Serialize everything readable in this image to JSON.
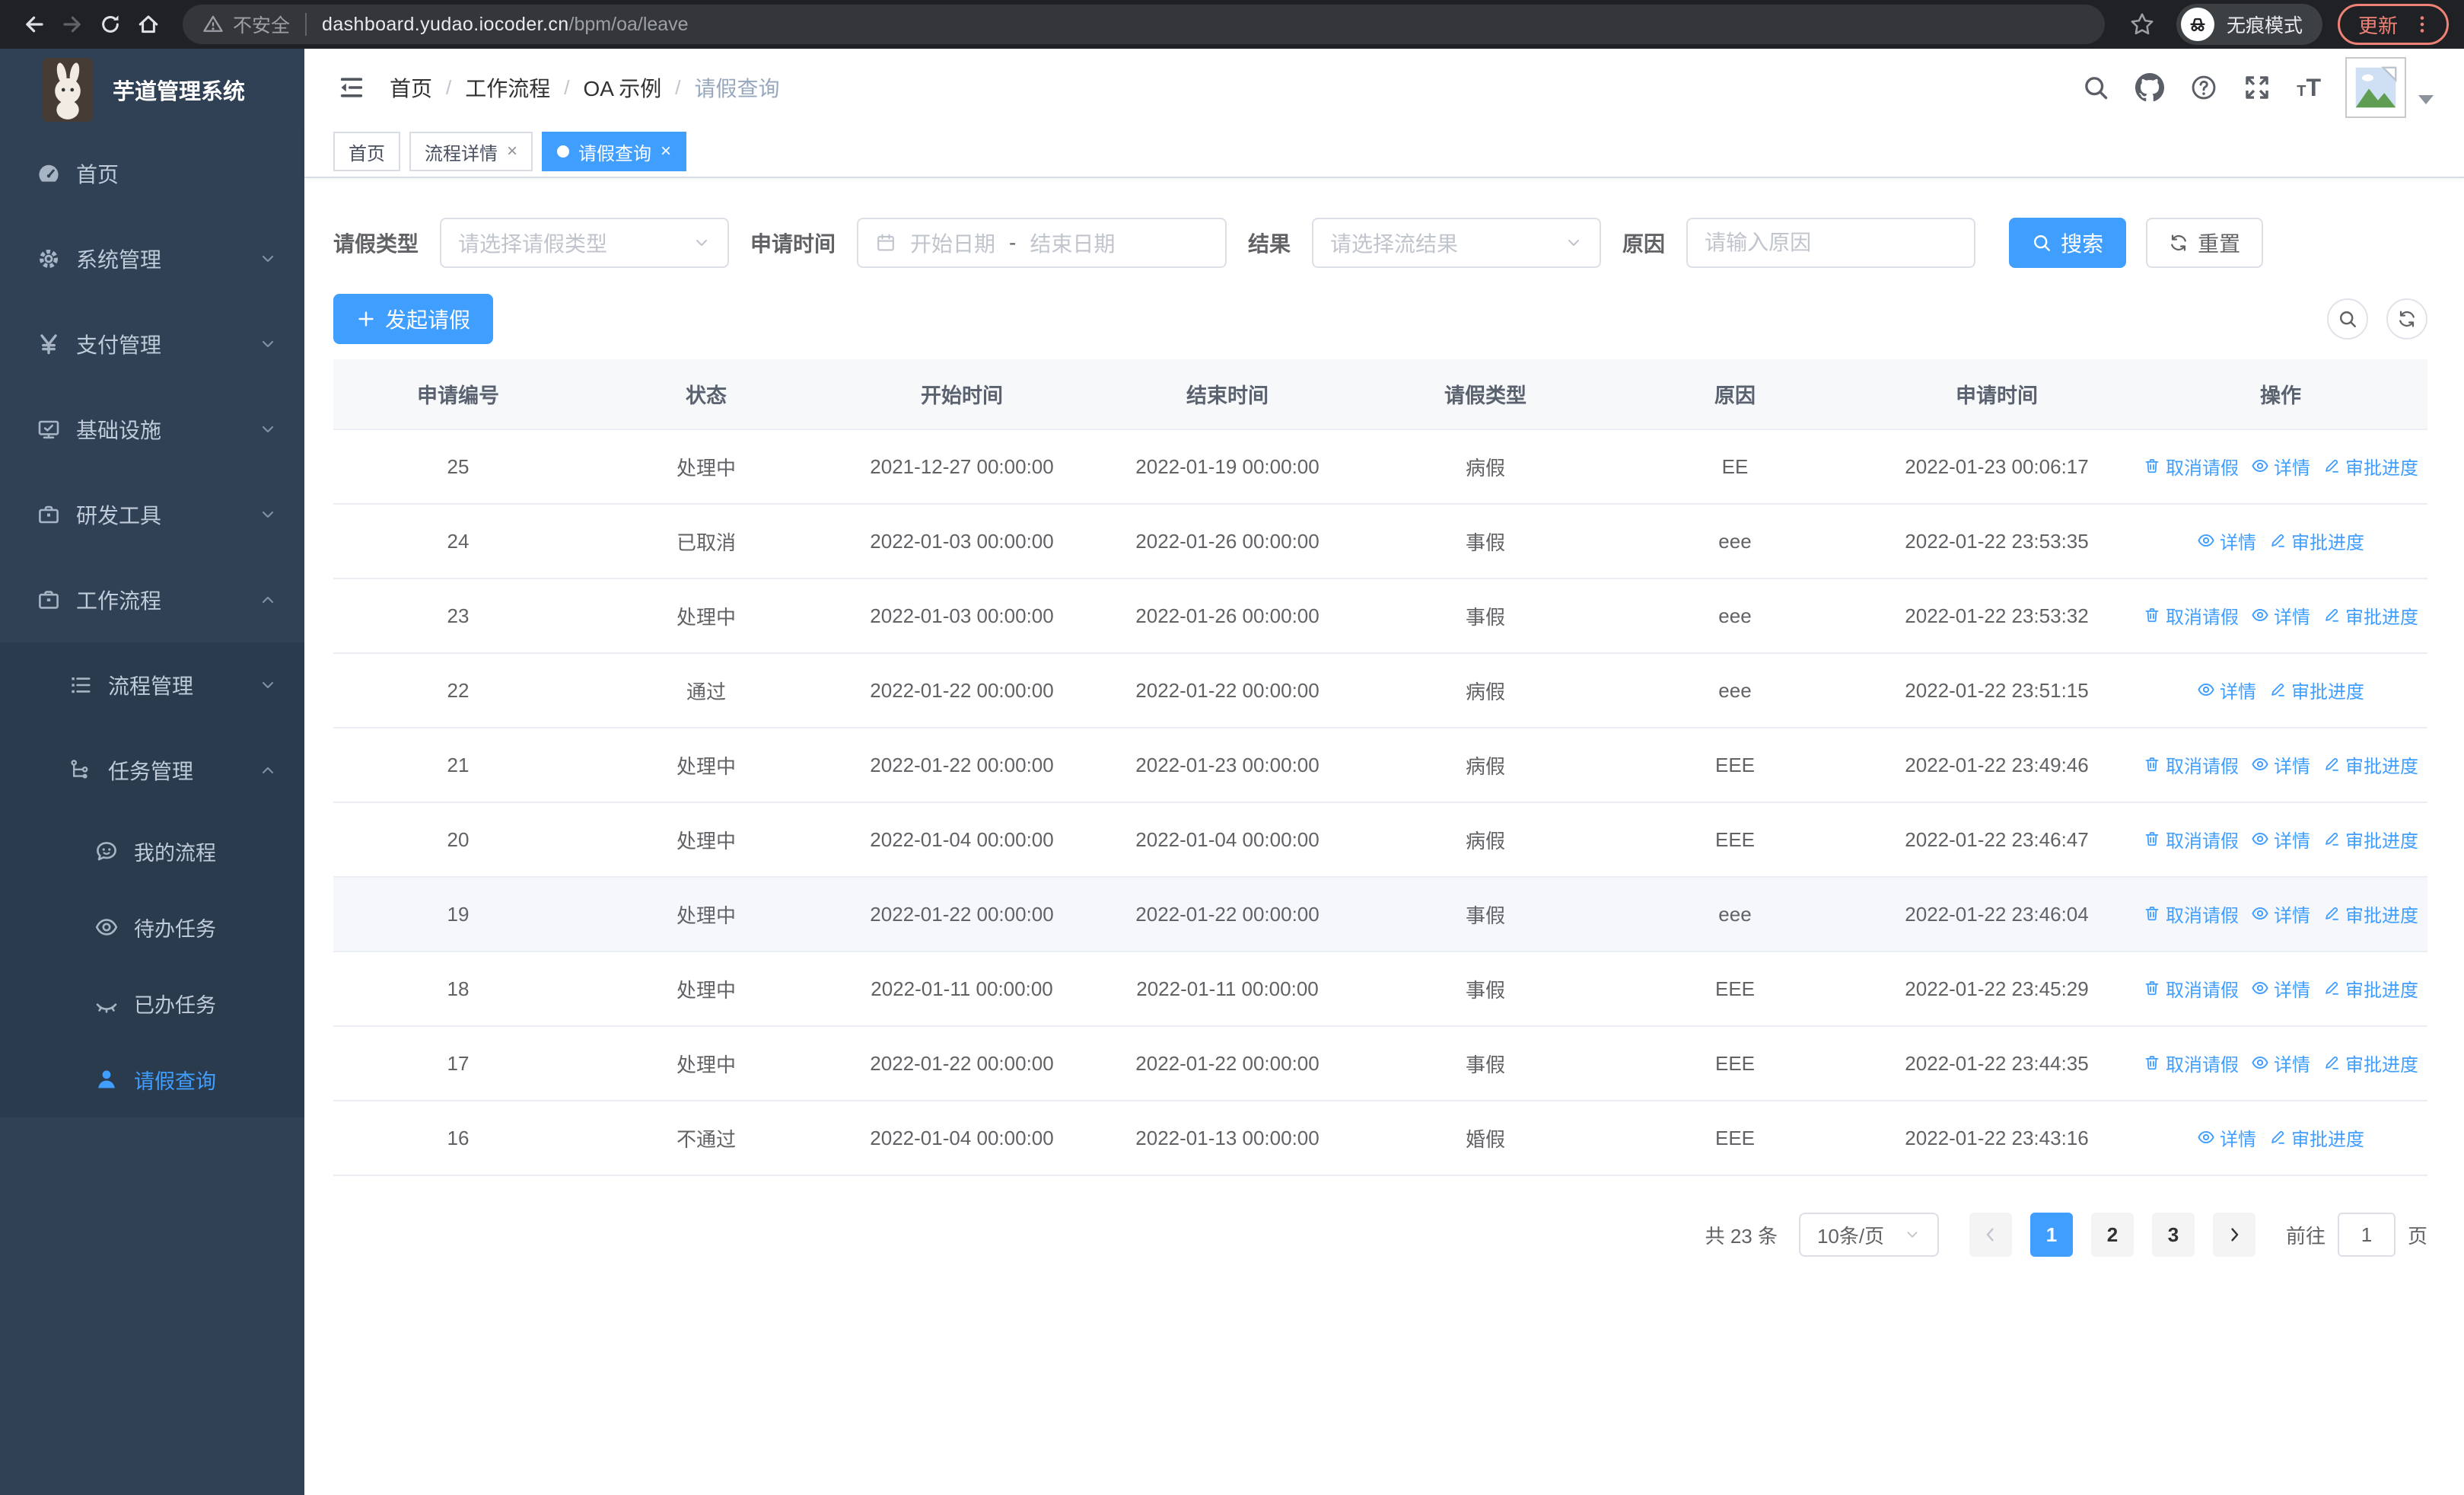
{
  "colors": {
    "primary": "#409EFF",
    "sidebar_bg": "#304156",
    "sidebar_sub_bg": "#2B3B4E",
    "sidebar_text": "#BFCBD9",
    "update_accent": "#EE8277",
    "table_border": "#EBEEF5",
    "header_row_bg": "#F7F8FA"
  },
  "browser": {
    "security_label": "不安全",
    "url_host": "dashboard.yudao.iocoder.cn",
    "url_path": "/bpm/oa/leave",
    "incognito_label": "无痕模式",
    "update_label": "更新"
  },
  "sidebar": {
    "title": "芋道管理系统",
    "items": [
      {
        "label": "首页"
      },
      {
        "label": "系统管理"
      },
      {
        "label": "支付管理"
      },
      {
        "label": "基础设施"
      },
      {
        "label": "研发工具"
      },
      {
        "label": "工作流程"
      }
    ],
    "sub_items": [
      {
        "label": "流程管理"
      },
      {
        "label": "任务管理"
      }
    ],
    "task_children": [
      {
        "label": "我的流程"
      },
      {
        "label": "待办任务"
      },
      {
        "label": "已办任务"
      },
      {
        "label": "请假查询"
      }
    ]
  },
  "header": {
    "breadcrumb": [
      "首页",
      "工作流程",
      "OA 示例",
      "请假查询"
    ],
    "breadcrumb_sep": "/"
  },
  "tabs": [
    {
      "label": "首页"
    },
    {
      "label": "流程详情"
    },
    {
      "label": "请假查询"
    }
  ],
  "filters": {
    "type_label": "请假类型",
    "type_placeholder": "请选择请假类型",
    "time_label": "申请时间",
    "time_start": "开始日期",
    "time_sep": "-",
    "time_end": "结束日期",
    "result_label": "结果",
    "result_placeholder": "请选择流结果",
    "reason_label": "原因",
    "reason_placeholder": "请输入原因",
    "search": "搜索",
    "reset": "重置"
  },
  "toolbar": {
    "create": "发起请假"
  },
  "table": {
    "columns": [
      "申请编号",
      "状态",
      "开始时间",
      "结束时间",
      "请假类型",
      "原因",
      "申请时间",
      "操作"
    ],
    "actions": {
      "cancel": "取消请假",
      "detail": "详情",
      "progress": "审批进度"
    },
    "rows": [
      {
        "id": "25",
        "status": "处理中",
        "start": "2021-12-27 00:00:00",
        "end": "2022-01-19 00:00:00",
        "type": "病假",
        "reason": "EE",
        "applied": "2022-01-23 00:06:17"
      },
      {
        "id": "24",
        "status": "已取消",
        "start": "2022-01-03 00:00:00",
        "end": "2022-01-26 00:00:00",
        "type": "事假",
        "reason": "eee",
        "applied": "2022-01-22 23:53:35"
      },
      {
        "id": "23",
        "status": "处理中",
        "start": "2022-01-03 00:00:00",
        "end": "2022-01-26 00:00:00",
        "type": "事假",
        "reason": "eee",
        "applied": "2022-01-22 23:53:32"
      },
      {
        "id": "22",
        "status": "通过",
        "start": "2022-01-22 00:00:00",
        "end": "2022-01-22 00:00:00",
        "type": "病假",
        "reason": "eee",
        "applied": "2022-01-22 23:51:15"
      },
      {
        "id": "21",
        "status": "处理中",
        "start": "2022-01-22 00:00:00",
        "end": "2022-01-23 00:00:00",
        "type": "病假",
        "reason": "EEE",
        "applied": "2022-01-22 23:49:46"
      },
      {
        "id": "20",
        "status": "处理中",
        "start": "2022-01-04 00:00:00",
        "end": "2022-01-04 00:00:00",
        "type": "病假",
        "reason": "EEE",
        "applied": "2022-01-22 23:46:47"
      },
      {
        "id": "19",
        "status": "处理中",
        "start": "2022-01-22 00:00:00",
        "end": "2022-01-22 00:00:00",
        "type": "事假",
        "reason": "eee",
        "applied": "2022-01-22 23:46:04"
      },
      {
        "id": "18",
        "status": "处理中",
        "start": "2022-01-11 00:00:00",
        "end": "2022-01-11 00:00:00",
        "type": "事假",
        "reason": "EEE",
        "applied": "2022-01-22 23:45:29"
      },
      {
        "id": "17",
        "status": "处理中",
        "start": "2022-01-22 00:00:00",
        "end": "2022-01-22 00:00:00",
        "type": "事假",
        "reason": "EEE",
        "applied": "2022-01-22 23:44:35"
      },
      {
        "id": "16",
        "status": "不通过",
        "start": "2022-01-04 00:00:00",
        "end": "2022-01-13 00:00:00",
        "type": "婚假",
        "reason": "EEE",
        "applied": "2022-01-22 23:43:16"
      }
    ]
  },
  "pagination": {
    "total": "共 23 条",
    "size": "10条/页",
    "pages": [
      "1",
      "2",
      "3"
    ],
    "goto": "前往",
    "goto_value": "1",
    "unit": "页"
  }
}
